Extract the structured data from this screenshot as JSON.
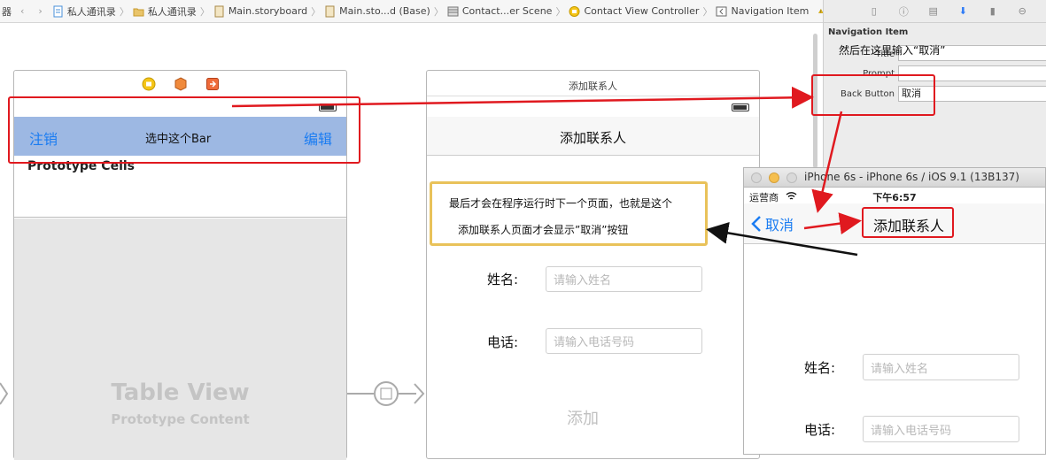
{
  "jumpbar": {
    "items": [
      {
        "label": "私人通讯录",
        "icon": "file-icon"
      },
      {
        "label": "私人通讯录",
        "icon": "folder-icon"
      },
      {
        "label": "Main.storyboard",
        "icon": "storyboard-icon"
      },
      {
        "label": "Main.sto...d (Base)",
        "icon": "storyboard-icon"
      },
      {
        "label": "Contact...er Scene",
        "icon": "scene-icon"
      },
      {
        "label": "Contact View Controller",
        "icon": "controller-icon"
      },
      {
        "label": "Navigation Item",
        "icon": "navigation-item-icon"
      }
    ],
    "left_fragment": "器"
  },
  "inspector": {
    "section_title": "Navigation Item",
    "fields": [
      {
        "label": "Title",
        "value": ""
      },
      {
        "label": "Prompt",
        "value": ""
      },
      {
        "label": "Back Button",
        "value": "取消"
      }
    ]
  },
  "annotations": {
    "inspector_note": "然后在这里输入“取消”",
    "select_bar_note": "选中这个Bar",
    "result_note_line1": "最后才会在程序运行时下一个页面，也就是这个",
    "result_note_line2": "添加联系人页面才会显示”取消”按钮"
  },
  "scene_left": {
    "nav_left": "注销",
    "nav_right": "编辑",
    "section_header": "Prototype Cells",
    "table_title": "Table View",
    "table_subtitle": "Prototype Content"
  },
  "scene_right": {
    "header": "添加联系人",
    "nav_title": "添加联系人",
    "name_label": "姓名:",
    "name_placeholder": "请输入姓名",
    "phone_label": "电话:",
    "phone_placeholder": "请输入电话号码",
    "add_button": "添加"
  },
  "simulator": {
    "window_title": "iPhone 6s - iPhone 6s / iOS 9.1 (13B137)",
    "carrier": "运营商",
    "time": "下午6:57",
    "back_label": "取消",
    "nav_title": "添加联系人",
    "name_label": "姓名:",
    "name_placeholder": "请输入姓名",
    "phone_label": "电话:",
    "phone_placeholder": "请输入电话号码"
  },
  "colors": {
    "accent_blue": "#1a7cf2",
    "selected_bar": "#9db8e3",
    "annotation_red": "#e0191f",
    "note_border": "#e9c25a"
  }
}
